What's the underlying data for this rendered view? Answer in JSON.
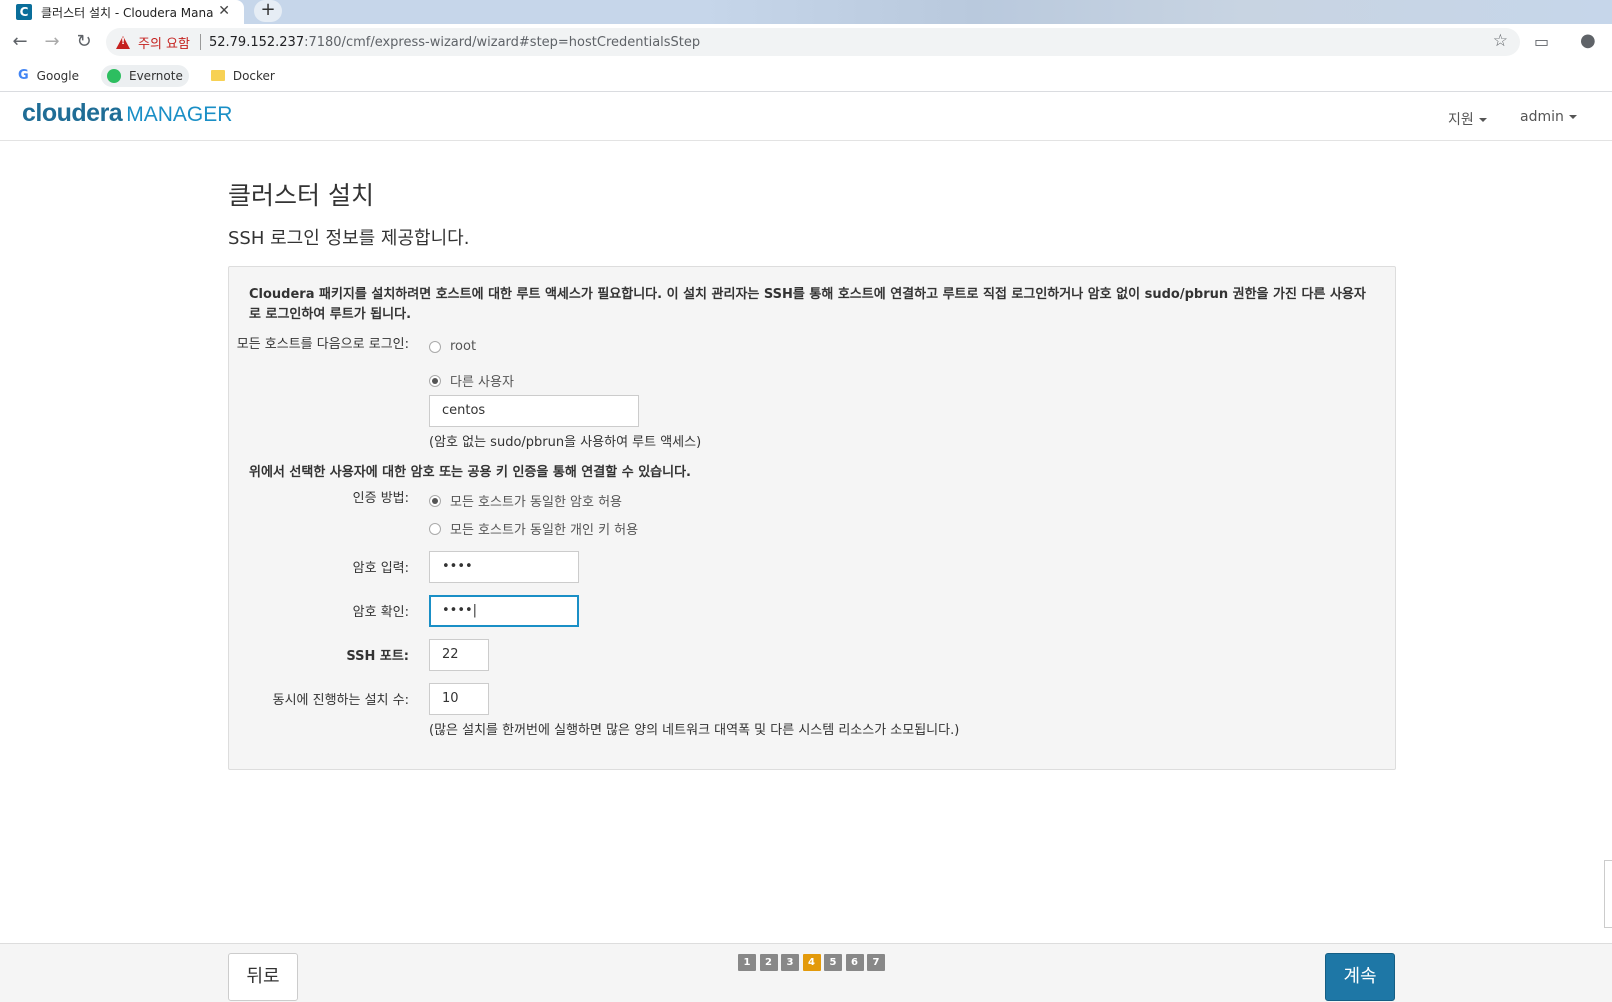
{
  "browser": {
    "tab_title": "클러스터 설치 - Cloudera Mana",
    "tab_favicon": "C",
    "url_warning": "주의 요함",
    "url_host": "52.79.152.237",
    "url_rest": ":7180/cmf/express-wizard/wizard#step=hostCredentialsStep",
    "bookmarks": [
      "Google",
      "Evernote",
      "Docker"
    ]
  },
  "app": {
    "logo_main": "cloudera",
    "logo_sub": "MANAGER",
    "nav_support": "지원",
    "nav_user": "admin"
  },
  "page": {
    "title": "클러스터 설치",
    "subtitle": "SSH 로그인 정보를 제공합니다.",
    "intro": "Cloudera 패키지를 설치하려면 호스트에 대한 루트 액세스가 필요합니다. 이 설치 관리자는 SSH를 통해 호스트에 연결하고 루트로 직접 로그인하거나 암호 없이 sudo/pbrun 권한을 가진 다른 사용자로 로그인하여 루트가 됩니다.",
    "login_label": "모든 호스트를 다음으로 로그인:",
    "login_options": [
      "root",
      "다른 사용자"
    ],
    "username": "centos",
    "username_hint": "(암호 없는 sudo/pbrun을 사용하여 루트 액세스)",
    "auth_intro": "위에서 선택한 사용자에 대한 암호 또는 공용 키 인증을 통해 연결할 수 있습니다.",
    "auth_label": "인증 방법:",
    "auth_options": [
      "모든 호스트가 동일한 암호 허용",
      "모든 호스트가 동일한 개인 키 허용"
    ],
    "password_label": "암호 입력:",
    "password_value": "••••",
    "confirm_label": "암호 확인:",
    "confirm_value": "••••|",
    "ssh_port_label": "SSH 포트:",
    "ssh_port": "22",
    "parallel_label": "동시에 진행하는 설치 수:",
    "parallel_value": "10",
    "parallel_hint": "(많은 설치를 한꺼번에 실행하면 많은 양의 네트워크 대역폭 및 다른 시스템 리소스가 소모됩니다.)"
  },
  "footer": {
    "back_label": "뒤로",
    "next_label": "계속",
    "steps": [
      "1",
      "2",
      "3",
      "4",
      "5",
      "6",
      "7"
    ],
    "current_step": "4"
  }
}
